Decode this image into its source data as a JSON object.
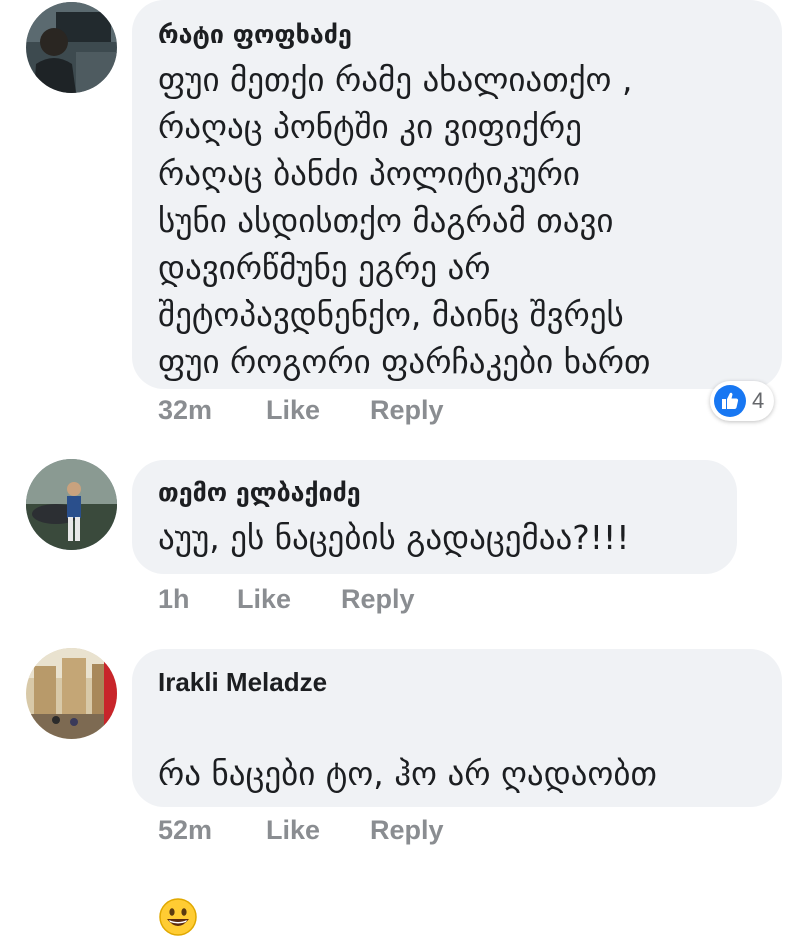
{
  "comments": [
    {
      "author": "რატი ფოფხაძე",
      "text": "ფუი მეთქი რამე ახალიათქო ,\nრაღაც პონტში კი ვიფიქრე\nრაღაც ბანძი პოლიტიკური\nსუნი ასდისთქო მაგრამ თავი\nდავირწმუნე ეგრე არ\nშეტოპავდნენქო, მაინც შვრეს\nფუი როგორი ფარჩაკები ხართ",
      "time": "32m",
      "like_label": "Like",
      "reply_label": "Reply",
      "reaction_count": "4"
    },
    {
      "author": "თემო ელბაქიძე",
      "text": "აუუ, ეს ნაცების გადაცემაა?!!!",
      "time": "1h",
      "like_label": "Like",
      "reply_label": "Reply"
    },
    {
      "author": "Irakli Meladze",
      "text": "რა ნაცები ტო, ჰო არ ღადაობთ",
      "time": "52m",
      "like_label": "Like",
      "reply_label": "Reply",
      "emoji": "grinning-face-icon"
    }
  ],
  "colors": {
    "bubble": "#f0f2f5",
    "meta_text": "#8a8d91",
    "like_blue": "#1877f2"
  }
}
